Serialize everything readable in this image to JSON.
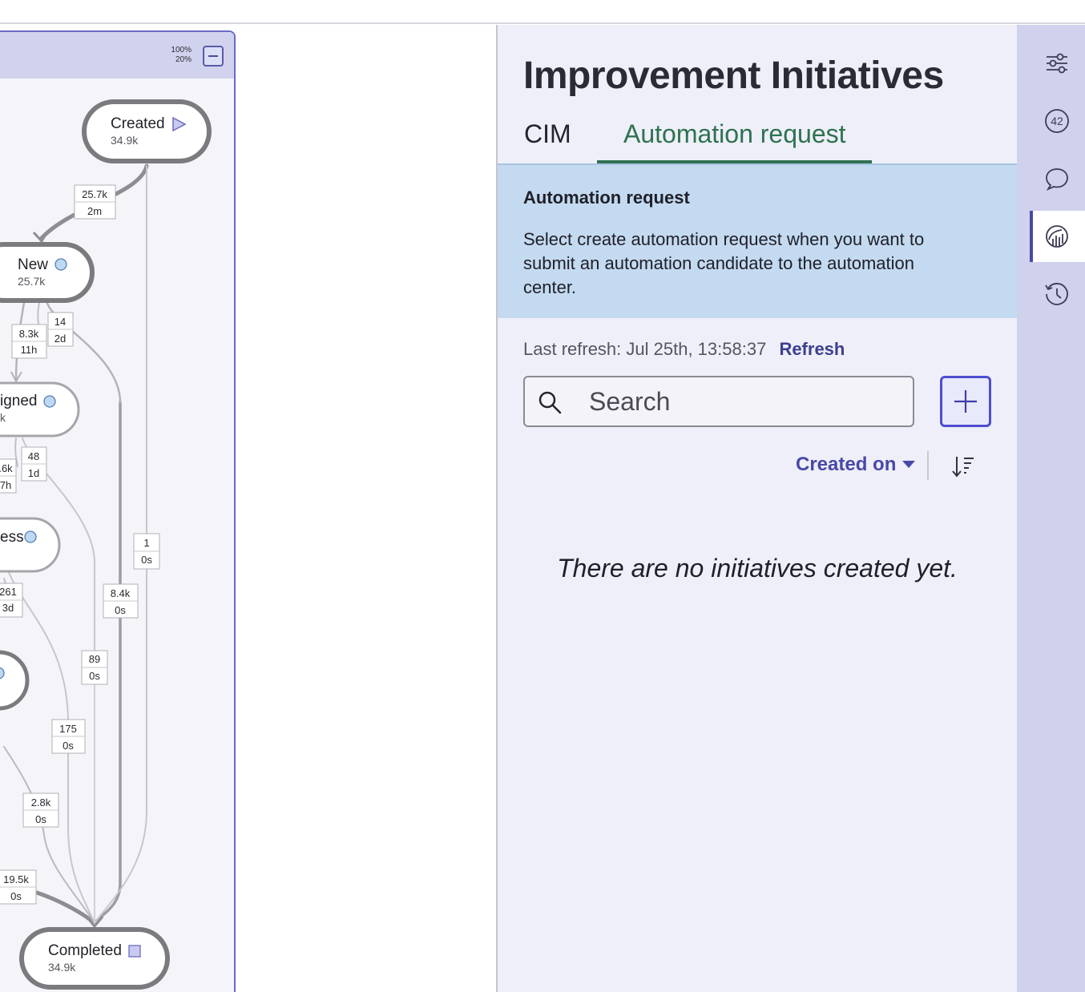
{
  "process_map": {
    "zoom_outer": "100%",
    "zoom_inner": "20%",
    "nodes": [
      {
        "name": "Created",
        "count": "34.9k",
        "marker": "start-triangle"
      },
      {
        "name": "New",
        "count": "25.7k",
        "marker": "circle"
      },
      {
        "name": "igned",
        "count": "k",
        "marker": "circle"
      },
      {
        "name": "ess",
        "count": "",
        "marker": "circle"
      },
      {
        "name": "",
        "count": "",
        "marker": "circle"
      },
      {
        "name": "Completed",
        "count": "34.9k",
        "marker": "end-square"
      }
    ],
    "edges": [
      {
        "count": "25.7k",
        "time": "2m"
      },
      {
        "count": "8.3k",
        "time": "11h"
      },
      {
        "count": "14",
        "time": "2d"
      },
      {
        "count": ".6k",
        "time": "7h"
      },
      {
        "count": "48",
        "time": "1d"
      },
      {
        "count": "1",
        "time": "0s"
      },
      {
        "count": "261",
        "time": "3d"
      },
      {
        "count": "8.4k",
        "time": "0s"
      },
      {
        "count": "89",
        "time": "0s"
      },
      {
        "count": "175",
        "time": "0s"
      },
      {
        "count": "2.8k",
        "time": "0s"
      },
      {
        "count": "19.5k",
        "time": "0s"
      }
    ]
  },
  "panel": {
    "title": "Improvement Initiatives",
    "tabs": [
      {
        "label": "CIM",
        "active": false
      },
      {
        "label": "Automation request",
        "active": true
      }
    ],
    "info": {
      "title": "Automation request",
      "text": "Select create automation request when you want to submit an automation candidate to the automation center."
    },
    "last_refresh": "Last refresh: Jul 25th, 13:58:37",
    "refresh_label": "Refresh",
    "search": {
      "placeholder": "Search",
      "value": ""
    },
    "add_icon": "plus-icon",
    "sort_label": "Created on",
    "empty_message": "There are no initiatives created yet."
  },
  "rail": {
    "items": [
      {
        "icon": "sliders-icon",
        "active": false
      },
      {
        "icon": "number-42-icon",
        "active": false
      },
      {
        "icon": "speech-bubble-icon",
        "active": false
      },
      {
        "icon": "analytics-gauge-icon",
        "active": true
      },
      {
        "icon": "history-clock-icon",
        "active": false
      }
    ]
  },
  "colors": {
    "accent": "#4848a8",
    "tab_active": "#2e7250",
    "info_bg": "#c4daf0",
    "panel_bg": "#eeeff8",
    "rail_bg": "#d0d1ec"
  }
}
